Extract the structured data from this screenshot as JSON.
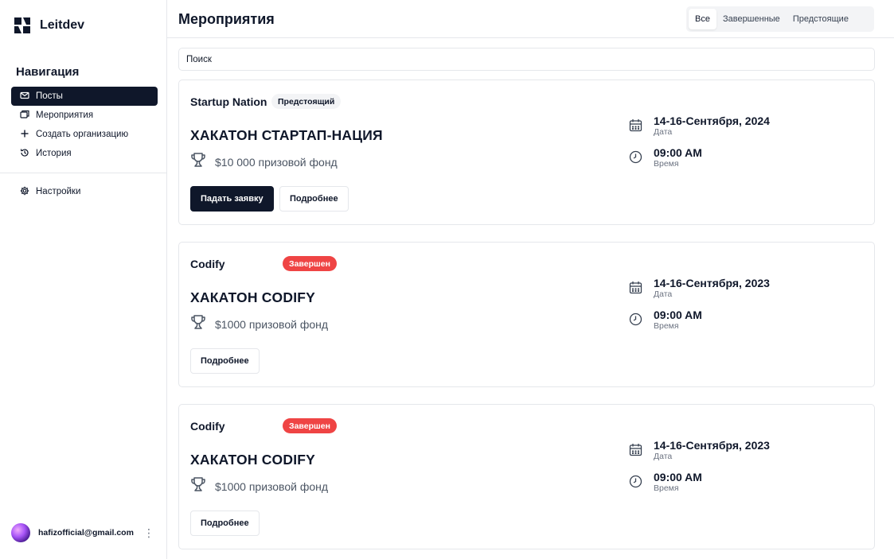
{
  "app": {
    "name": "Leitdev"
  },
  "sidebar": {
    "nav_title": "Навигация",
    "items": [
      {
        "label": "Посты",
        "icon": "mail-icon",
        "active": true
      },
      {
        "label": "Мероприятия",
        "icon": "copy-icon",
        "active": false
      },
      {
        "label": "Создать организацию",
        "icon": "plus-icon",
        "active": false
      },
      {
        "label": "История",
        "icon": "history-icon",
        "active": false
      }
    ],
    "settings": {
      "label": "Настройки",
      "icon": "gear-icon"
    },
    "user": {
      "email": "hafizofficial@gmail.com"
    }
  },
  "header": {
    "title": "Мероприятия",
    "filters": [
      {
        "label": "Все",
        "active": true
      },
      {
        "label": "Завершенные",
        "active": false
      },
      {
        "label": "Предстоящие",
        "active": false
      }
    ]
  },
  "search": {
    "placeholder": "Поиск"
  },
  "events": [
    {
      "org": "Startup Nation",
      "status": "Предстоящий",
      "status_type": "upcoming",
      "title": "ХАКАТОН СТАРТАП-НАЦИЯ",
      "prize": "$10 000 призовой фонд",
      "date": "14-16-Сентября, 2024",
      "date_label": "Дата",
      "time": "09:00 AM",
      "time_label": "Время",
      "apply_label": "Падать заявку",
      "details_label": "Подробнее"
    },
    {
      "org": "Codify",
      "status": "Завершен",
      "status_type": "done",
      "title": "ХАКАТОН CODIFY",
      "prize": "$1000 призовой фонд",
      "date": "14-16-Сентября, 2023",
      "date_label": "Дата",
      "time": "09:00 AM",
      "time_label": "Время",
      "details_label": "Подробнее"
    },
    {
      "org": "Codify",
      "status": "Завершен",
      "status_type": "done",
      "title": "ХАКАТОН CODIFY",
      "prize": "$1000 призовой фонд",
      "date": "14-16-Сентября, 2023",
      "date_label": "Дата",
      "time": "09:00 AM",
      "time_label": "Время",
      "details_label": "Подробнее"
    }
  ],
  "colors": {
    "primary": "#0f172a",
    "danger": "#ef4444",
    "muted": "#6b7280",
    "border": "#e5e7eb"
  }
}
